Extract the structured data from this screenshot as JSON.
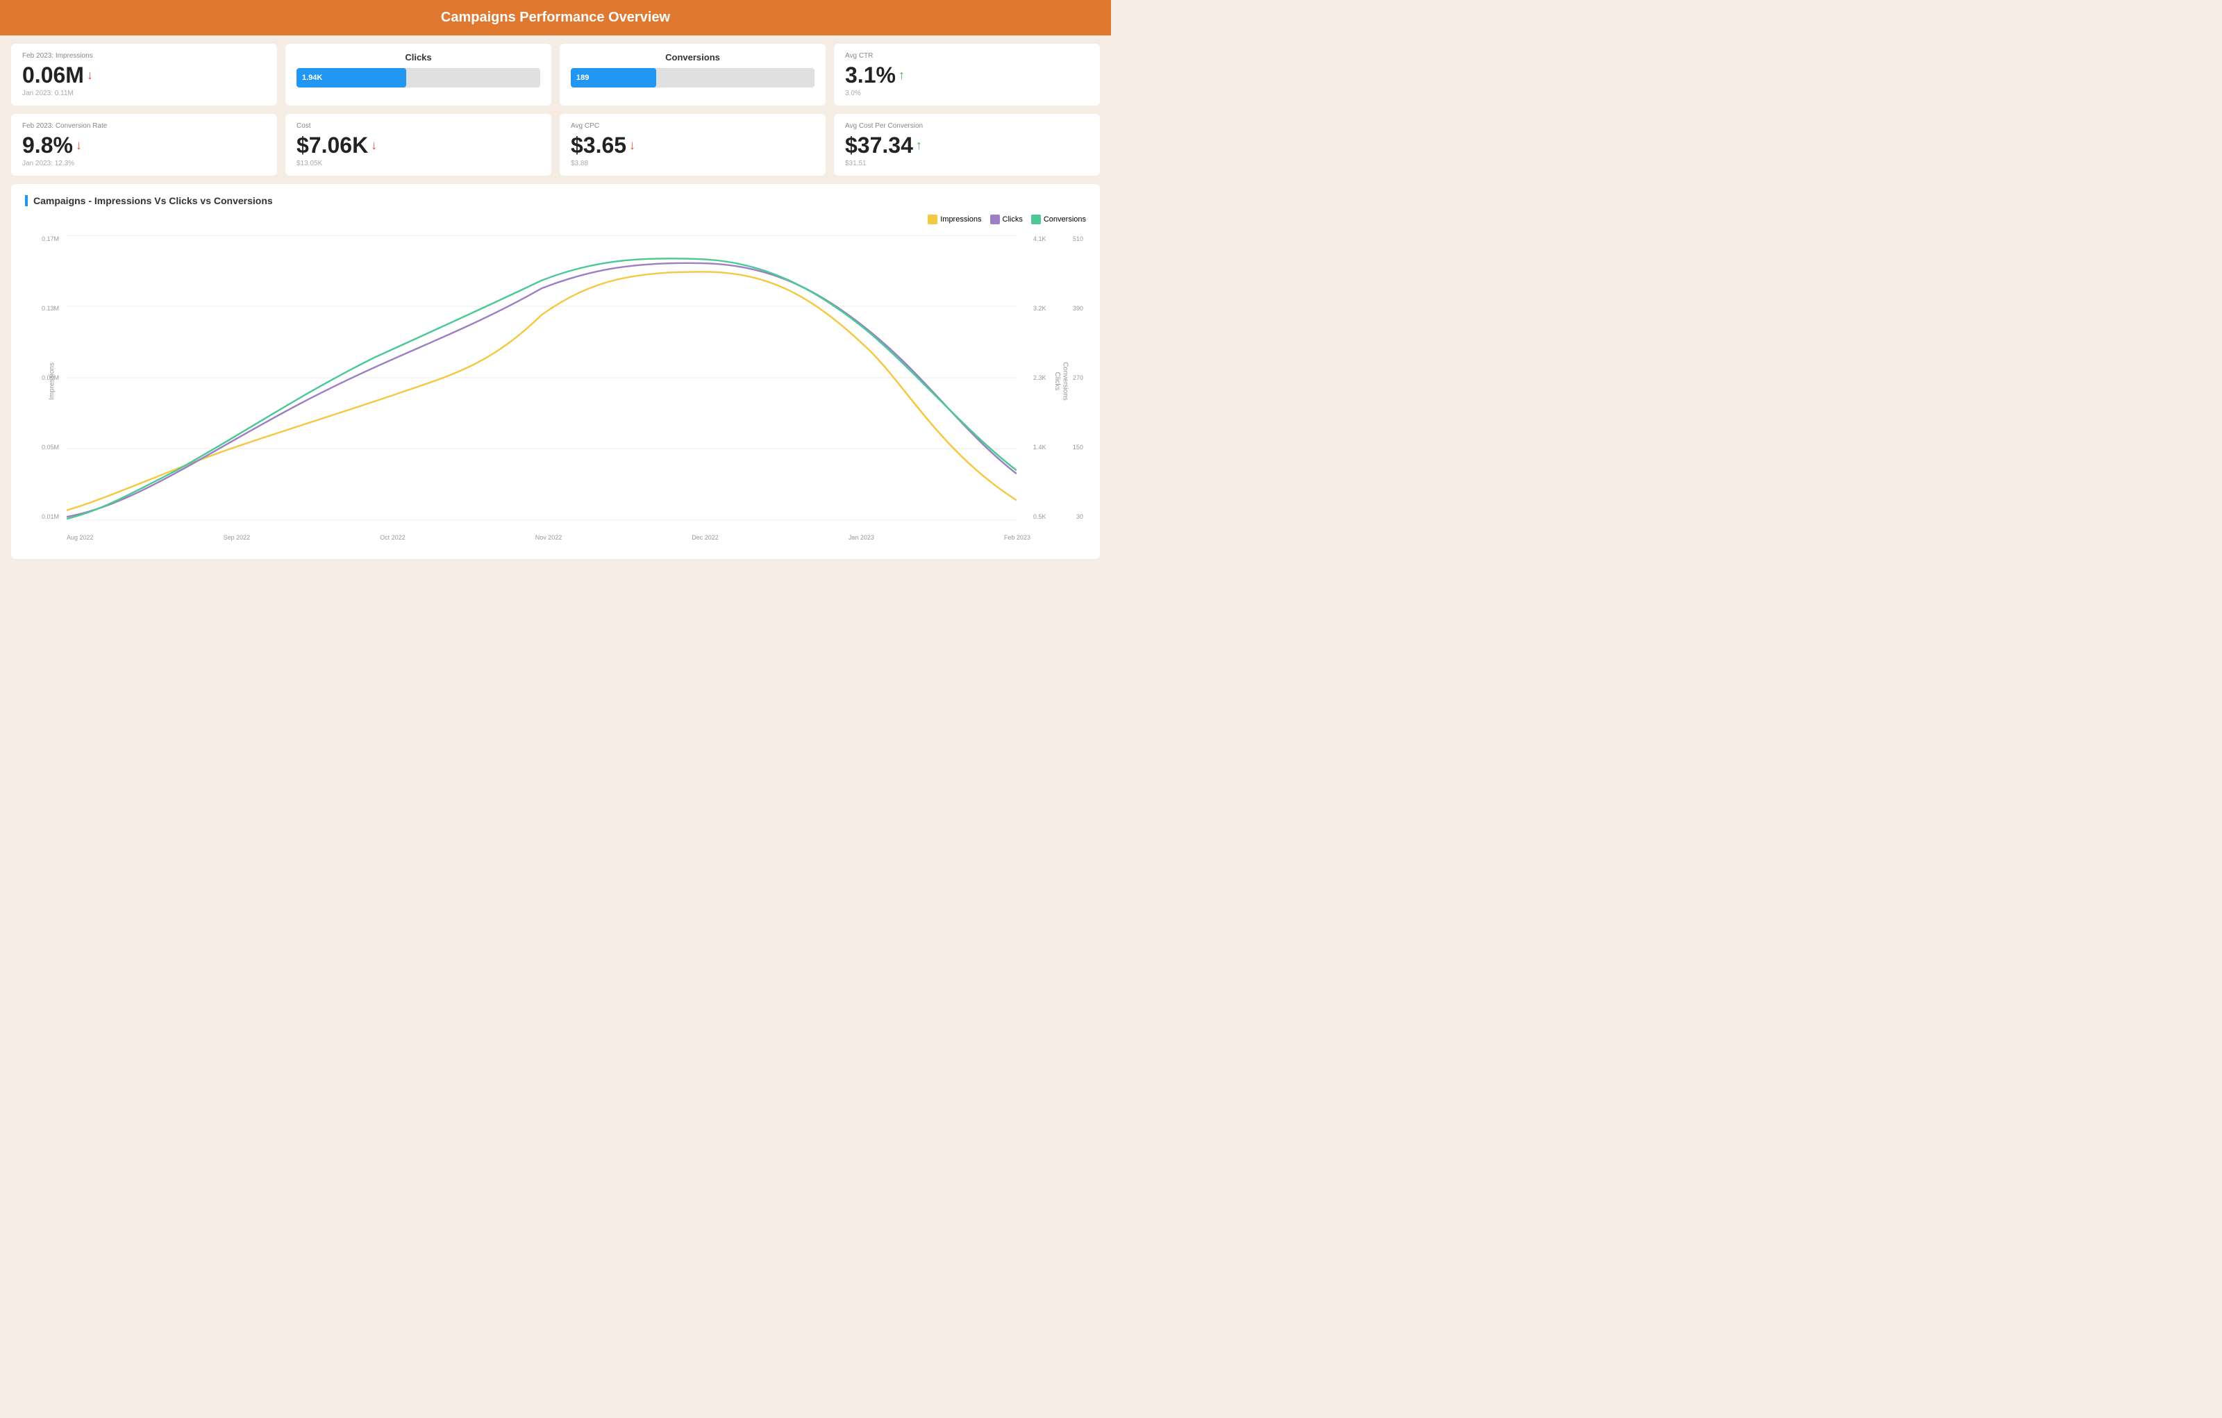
{
  "header": {
    "title": "Campaigns Performance Overview"
  },
  "metrics_row1": [
    {
      "id": "impressions",
      "label": "Feb 2023: Impressions",
      "value": "0.06M",
      "arrow": "down",
      "sub": "Jan 2023: 0.11M"
    },
    {
      "id": "clicks",
      "label": "Clicks",
      "bar_value": "1.94K",
      "bar_percent": 45,
      "type": "bar"
    },
    {
      "id": "conversions",
      "label": "Conversions",
      "bar_value": "189",
      "bar_percent": 35,
      "type": "bar"
    },
    {
      "id": "avg_ctr",
      "label": "Avg CTR",
      "value": "3.1%",
      "arrow": "up",
      "sub": "3.0%"
    }
  ],
  "metrics_row2": [
    {
      "id": "conversion_rate",
      "label": "Feb 2023: Conversion Rate",
      "value": "9.8%",
      "arrow": "down",
      "sub": "Jan 2023: 12.3%"
    },
    {
      "id": "cost",
      "label": "Cost",
      "value": "$7.06K",
      "arrow": "down",
      "sub": "$13.05K"
    },
    {
      "id": "avg_cpc",
      "label": "Avg CPC",
      "value": "$3.65",
      "arrow": "down",
      "sub": "$3.88"
    },
    {
      "id": "avg_cost_per_conversion",
      "label": "Avg Cost Per Conversion",
      "value": "$37.34",
      "arrow": "up",
      "sub": "$31.51"
    }
  ],
  "chart": {
    "title": "Campaigns - Impressions Vs Clicks vs Conversions",
    "legend": [
      {
        "label": "Impressions",
        "color": "#f5c842"
      },
      {
        "label": "Clicks",
        "color": "#9c7fc4"
      },
      {
        "label": "Conversions",
        "color": "#4bc994"
      }
    ],
    "y_left": [
      "0.17M",
      "0.13M",
      "0.09M",
      "0.05M",
      "0.01M"
    ],
    "y_right_clicks": [
      "4.1K",
      "3.2K",
      "2.3K",
      "1.4K",
      "0.5K"
    ],
    "y_right_conv": [
      "510",
      "390",
      "270",
      "150",
      "30"
    ],
    "x_labels": [
      "Aug 2022",
      "Sep 2022",
      "Oct 2022",
      "Nov 2022",
      "Dec 2022",
      "Jan 2023",
      "Feb 2023"
    ],
    "axis_title_left": "Impressions",
    "axis_title_right_clicks": "Clicks",
    "axis_title_right_conv": "Conversions"
  },
  "colors": {
    "header_bg": "#e07830",
    "impressions_line": "#f5c842",
    "clicks_line": "#9c7fc4",
    "conversions_line": "#4bc994",
    "bar_blue": "#2196f3",
    "down_arrow": "#e74c3c",
    "up_arrow": "#4caf50"
  }
}
